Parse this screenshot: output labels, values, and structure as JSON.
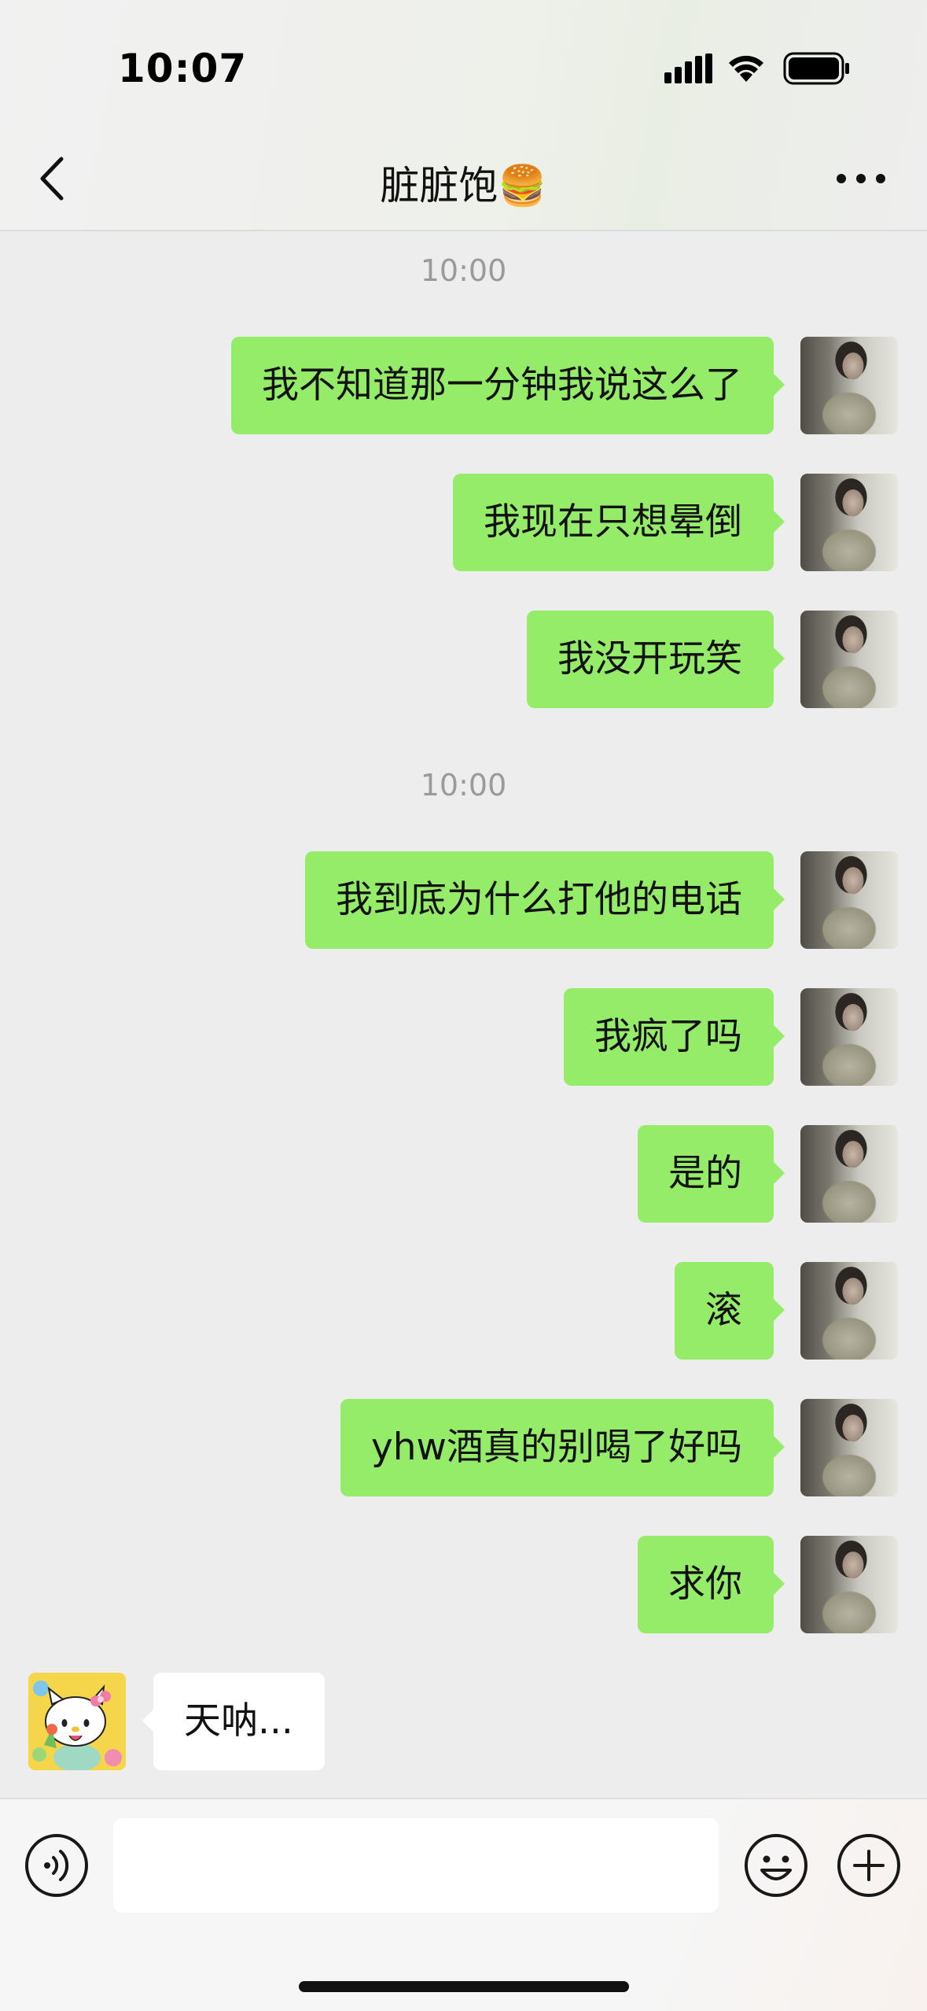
{
  "status_bar": {
    "time": "10:07",
    "icons": [
      "cellular-signal-icon",
      "wifi-icon",
      "battery-icon"
    ]
  },
  "nav": {
    "title": "脏脏饱🍔",
    "back_icon": "chevron-left-icon",
    "more_icon": "more-dots-icon"
  },
  "timestamps": [
    "10:00",
    "10:00"
  ],
  "messages": [
    {
      "side": "right",
      "text": "我不知道那一分钟我说这么了"
    },
    {
      "side": "right",
      "text": "我现在只想晕倒"
    },
    {
      "side": "right",
      "text": "我没开玩笑"
    },
    {
      "side": "right",
      "text": "我到底为什么打他的电话"
    },
    {
      "side": "right",
      "text": "我疯了吗"
    },
    {
      "side": "right",
      "text": "是的"
    },
    {
      "side": "right",
      "text": "滚"
    },
    {
      "side": "right",
      "text": "yhw酒真的别喝了好吗"
    },
    {
      "side": "right",
      "text": "求你"
    },
    {
      "side": "left",
      "text": "天呐..."
    }
  ],
  "input_bar": {
    "value": "",
    "icons": [
      "voice-icon",
      "emoji-icon",
      "plus-icon"
    ]
  },
  "colors": {
    "outgoing_bubble": "#95ec69",
    "incoming_bubble": "#ffffff",
    "chat_background": "#ededed"
  }
}
